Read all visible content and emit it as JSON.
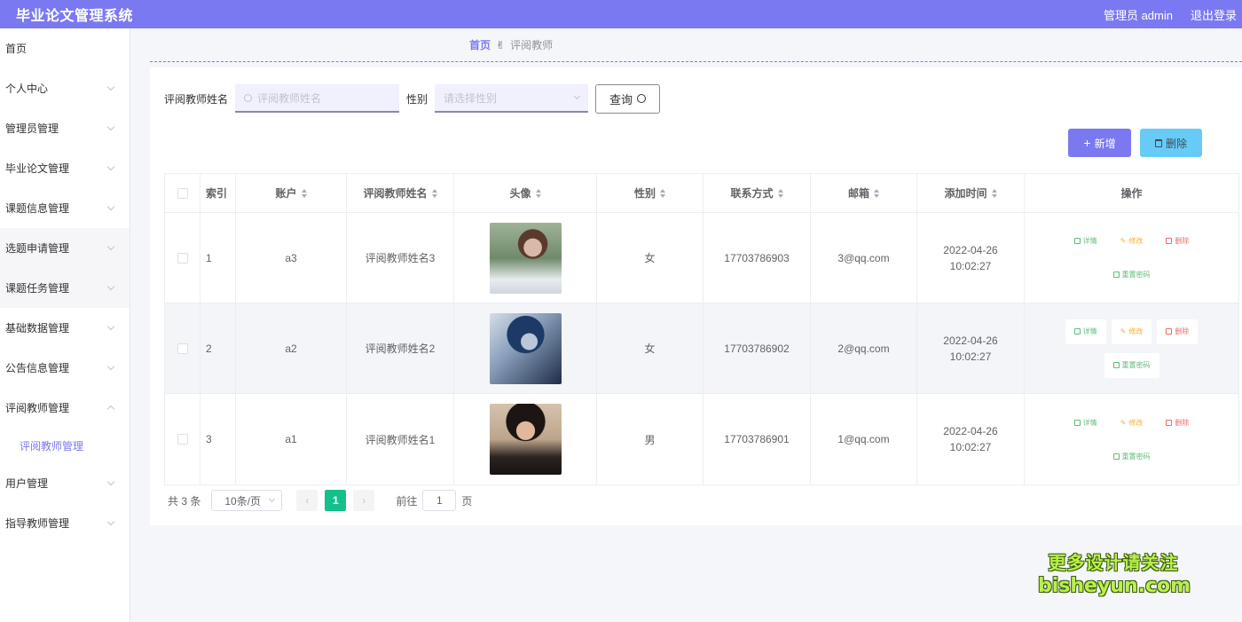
{
  "header": {
    "title": "毕业论文管理系统",
    "user": "管理员 admin",
    "logout": "退出登录"
  },
  "sidebar": {
    "items": [
      {
        "label": "首页",
        "chevron": false
      },
      {
        "label": "个人中心",
        "chevron": true
      },
      {
        "label": "管理员管理",
        "chevron": true
      },
      {
        "label": "毕业论文管理",
        "chevron": true
      },
      {
        "label": "课题信息管理",
        "chevron": true
      },
      {
        "label": "选题申请管理",
        "chevron": true
      },
      {
        "label": "课题任务管理",
        "chevron": true
      },
      {
        "label": "基础数据管理",
        "chevron": true
      },
      {
        "label": "公告信息管理",
        "chevron": true
      },
      {
        "label": "评阅教师管理",
        "chevron": true,
        "expanded": true
      },
      {
        "label": "用户管理",
        "chevron": true
      },
      {
        "label": "指导教师管理",
        "chevron": true
      }
    ],
    "sub_item": "评阅教师管理"
  },
  "breadcrumb": {
    "home": "首页",
    "current": "评阅教师"
  },
  "search": {
    "name_label": "评阅教师姓名",
    "name_placeholder": "评阅教师姓名",
    "sex_label": "性别",
    "sex_placeholder": "请选择性别",
    "query_button": "查询"
  },
  "actions": {
    "add": "新增",
    "delete": "删除"
  },
  "table": {
    "columns": [
      "索引",
      "账户",
      "评阅教师姓名",
      "头像",
      "性别",
      "联系方式",
      "邮箱",
      "添加时间",
      "操作"
    ],
    "rows": [
      {
        "index": "1",
        "account": "a3",
        "name": "评阅教师姓名3",
        "sex": "女",
        "phone": "17703786903",
        "email": "3@qq.com",
        "time": "2022-04-26 10:02:27"
      },
      {
        "index": "2",
        "account": "a2",
        "name": "评阅教师姓名2",
        "sex": "女",
        "phone": "17703786902",
        "email": "2@qq.com",
        "time": "2022-04-26 10:02:27"
      },
      {
        "index": "3",
        "account": "a1",
        "name": "评阅教师姓名1",
        "sex": "男",
        "phone": "17703786901",
        "email": "1@qq.com",
        "time": "2022-04-26 10:02:27"
      }
    ],
    "ops": {
      "detail": "详情",
      "edit": "修改",
      "remove": "删除",
      "reset": "重置密码"
    }
  },
  "pagination": {
    "total": "共 3 条",
    "page_size": "10条/页",
    "current_page": "1",
    "goto_prefix": "前往",
    "goto_value": "1",
    "goto_suffix": "页"
  },
  "watermark": {
    "line1": "更多设计请关注",
    "line2": "bisheyun.com"
  },
  "colors": {
    "primary": "#7b79f2",
    "info": "#66ccf7",
    "page_active": "#13c08c"
  }
}
